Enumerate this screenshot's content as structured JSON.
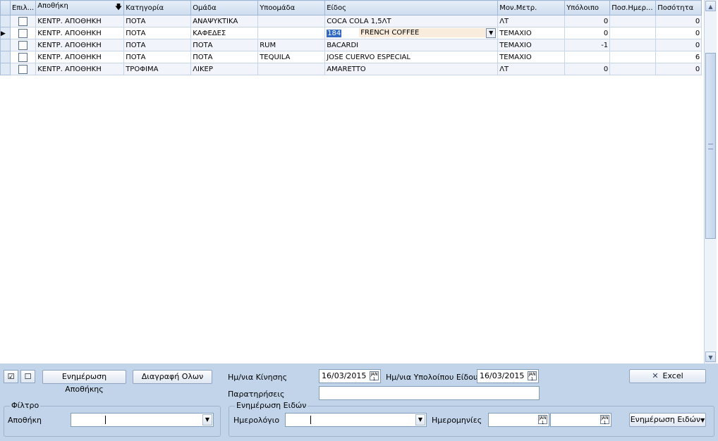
{
  "grid": {
    "headers": [
      "Επιλ...",
      "Αποθήκη",
      "Κατηγορία",
      "Ομάδα",
      "Υποομάδα",
      "Είδος",
      "Μον.Μετρ.",
      "Υπόλοιπο",
      "Ποσ.Ημερ...",
      "Ποσότητα"
    ],
    "rows": [
      {
        "store": "ΚΕΝΤΡ. ΑΠΟΘΗΚΗ",
        "category": "ΠΟΤΑ",
        "group": "ΑΝΑΨΥΚΤΙΚΑ",
        "subgroup": "",
        "item": "COCA COLA 1,5ΛΤ",
        "unit": "ΛΤ",
        "balance": "0",
        "dayqty": "",
        "qty": "0"
      },
      {
        "store": "ΚΕΝΤΡ. ΑΠΟΘΗΚΗ",
        "category": "ΠΟΤΑ",
        "group": "ΚΑΦΕΔΕΣ",
        "subgroup": "",
        "item_code": "184",
        "item": "FRENCH COFFEE",
        "unit": "ΤΕΜΑΧΙΟ",
        "balance": "0",
        "dayqty": "",
        "qty": "0"
      },
      {
        "store": "ΚΕΝΤΡ. ΑΠΟΘΗΚΗ",
        "category": "ΠΟΤΑ",
        "group": "ΠΟΤΑ",
        "subgroup": "RUM",
        "item": "BACARDI",
        "unit": "ΤΕΜΑΧΙΟ",
        "balance": "-1",
        "dayqty": "",
        "qty": "0"
      },
      {
        "store": "ΚΕΝΤΡ. ΑΠΟΘΗΚΗ",
        "category": "ΠΟΤΑ",
        "group": "ΠΟΤΑ",
        "subgroup": "TEQUILA",
        "item": "JOSE CUERVO ESPECIAL",
        "unit": "ΤΕΜΑΧΙΟ",
        "balance": "",
        "dayqty": "",
        "qty": "6"
      },
      {
        "store": "ΚΕΝΤΡ. ΑΠΟΘΗΚΗ",
        "category": "ΤΡΟΦΙΜΑ",
        "group": "ΛΙΚΕΡ",
        "subgroup": "",
        "item": "AMARETTO",
        "unit": "ΛΤ",
        "balance": "0",
        "dayqty": "",
        "qty": "0"
      }
    ]
  },
  "toolbar": {
    "check_all": "☑",
    "uncheck_all": "☐",
    "update_store": "Ενημέρωση Αποθήκης",
    "delete_all": "Διαγραφή Ολων",
    "excel": "Excel"
  },
  "form": {
    "move_date_label": "Ημ/νια Κίνησης",
    "move_date": "16/03/2015",
    "balance_date_label": "Ημ/νια Υπολοίπου Είδους",
    "balance_date": "16/03/2015",
    "notes_label": "Παρατηρήσεις",
    "notes": ""
  },
  "filter": {
    "legend": "Φίλτρο",
    "store_label": "Αποθήκη",
    "store_value": ""
  },
  "items_update": {
    "legend": "Ενημέρωση Ειδών",
    "journal_label": "Ημερολόγιο",
    "journal_value": "",
    "dates_label": "Ημερομηνίες",
    "date_from": "",
    "date_to": "",
    "button": "Ενημέρωση Ειδών"
  },
  "icons": {
    "calendar": "calendar-icon",
    "dropdown": "chevron-down-icon",
    "excel": "excel-icon",
    "sort": "sort-desc-icon"
  }
}
